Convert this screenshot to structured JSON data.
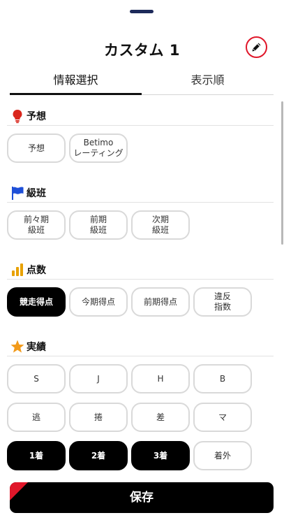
{
  "header": {
    "title": "カスタム 1"
  },
  "tabs": [
    {
      "label": "情報選択"
    },
    {
      "label": "表示順"
    }
  ],
  "sections": [
    {
      "title": "予想",
      "icon": "lightbulb-icon",
      "chips": [
        {
          "label": "予想",
          "selected": false
        },
        {
          "label": "Betimo\nレーティング",
          "selected": false
        }
      ]
    },
    {
      "title": "級班",
      "icon": "flag-icon",
      "chips": [
        {
          "label": "前々期\n級班",
          "selected": false
        },
        {
          "label": "前期\n級班",
          "selected": false
        },
        {
          "label": "次期\n級班",
          "selected": false
        }
      ]
    },
    {
      "title": "点数",
      "icon": "bar-chart-icon",
      "chips": [
        {
          "label": "競走得点",
          "selected": true
        },
        {
          "label": "今期得点",
          "selected": false
        },
        {
          "label": "前期得点",
          "selected": false
        },
        {
          "label": "違反\n指数",
          "selected": false
        }
      ]
    },
    {
      "title": "実績",
      "icon": "star-icon",
      "chips": [
        {
          "label": "S",
          "selected": false
        },
        {
          "label": "J",
          "selected": false
        },
        {
          "label": "H",
          "selected": false
        },
        {
          "label": "B",
          "selected": false
        },
        {
          "label": "逃",
          "selected": false
        },
        {
          "label": "捲",
          "selected": false
        },
        {
          "label": "差",
          "selected": false
        },
        {
          "label": "マ",
          "selected": false
        },
        {
          "label": "1着",
          "selected": true
        },
        {
          "label": "2着",
          "selected": true
        },
        {
          "label": "3着",
          "selected": true
        },
        {
          "label": "着外",
          "selected": false
        }
      ]
    }
  ],
  "footer": {
    "save_label": "保存"
  },
  "colors": {
    "accent": "#e0172a",
    "selected_bg": "#000000",
    "chip_border": "#d9d9d9",
    "flag": "#1e4fd8",
    "bulb": "#d9261c",
    "bars": "#e8a100",
    "star": "#f29a1a"
  }
}
